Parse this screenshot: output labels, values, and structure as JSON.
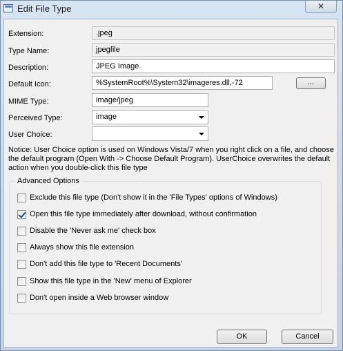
{
  "window": {
    "title": "Edit File Type",
    "close_label": "✕"
  },
  "labels": {
    "extension": "Extension:",
    "type_name": "Type Name:",
    "description": "Description:",
    "default_icon": "Default Icon:",
    "mime_type": "MIME Type:",
    "perceived_type": "Perceived Type:",
    "user_choice": "User Choice:"
  },
  "values": {
    "extension": ".jpeg",
    "type_name": "jpegfile",
    "description": "JPEG Image",
    "default_icon": "%SystemRoot%\\System32\\imageres.dll,-72",
    "mime_type": "image/jpeg",
    "perceived_type": "image",
    "user_choice": ""
  },
  "browse_label": "...",
  "notice": "Notice: User Choice option is used on Windows Vista/7 when you right click on a file, and choose the default program (Open With -> Choose Default Program). UserChoice overwrites the default action when you double-click this file type",
  "advanced": {
    "title": "Advanced Options",
    "options": [
      {
        "label": "Exclude  this file type (Don't show it in the 'File Types' options of Windows)",
        "checked": false
      },
      {
        "label": "Open this file type immediately after download, without confirmation",
        "checked": true
      },
      {
        "label": "Disable the 'Never ask me' check box",
        "checked": false
      },
      {
        "label": "Always show this file extension",
        "checked": false
      },
      {
        "label": "Don't add this file type to 'Recent Documents'",
        "checked": false
      },
      {
        "label": "Show this file type in the 'New' menu of Explorer",
        "checked": false
      },
      {
        "label": "Don't open inside a Web browser window",
        "checked": false
      }
    ]
  },
  "buttons": {
    "ok": "OK",
    "cancel": "Cancel"
  }
}
